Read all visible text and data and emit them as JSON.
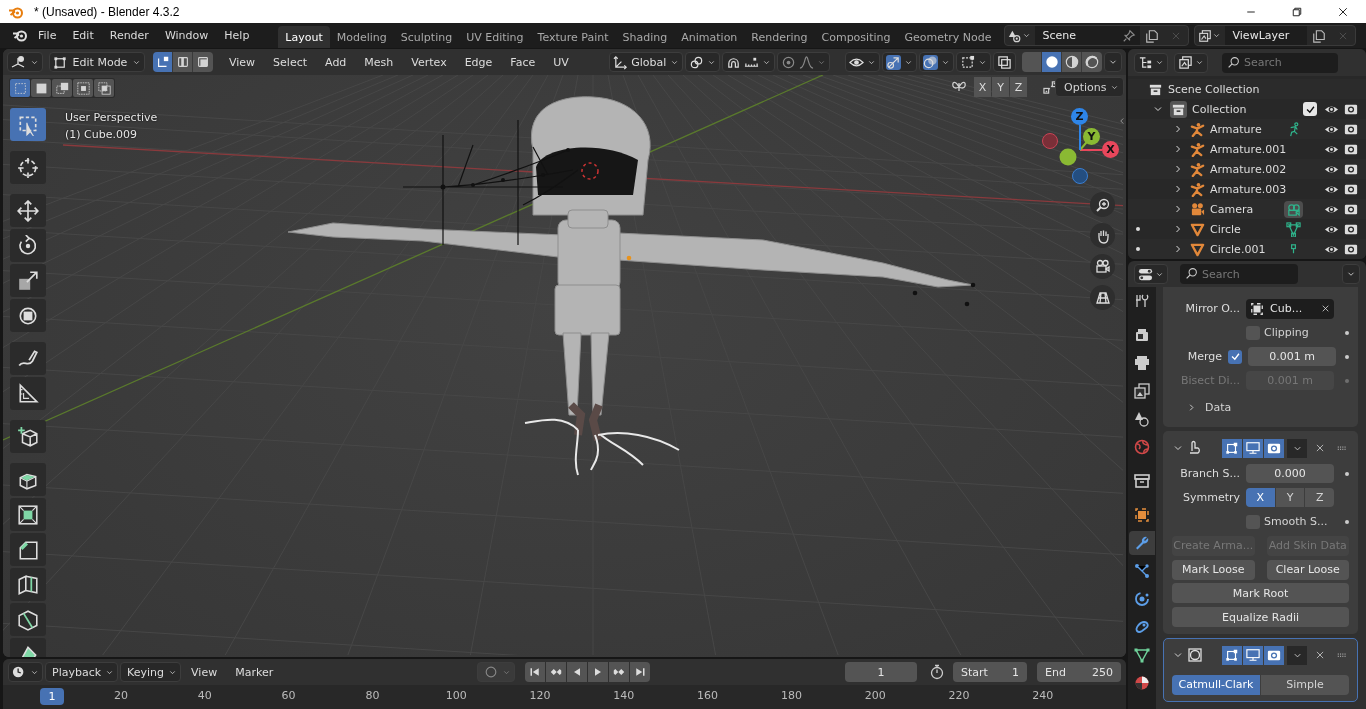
{
  "window": {
    "title": "* (Unsaved) - Blender 4.3.2"
  },
  "menu": [
    "File",
    "Edit",
    "Render",
    "Window",
    "Help"
  ],
  "workspaces": [
    {
      "label": "Layout",
      "selected": true
    },
    {
      "label": "Modeling",
      "selected": false
    },
    {
      "label": "Sculpting",
      "selected": false
    },
    {
      "label": "UV Editing",
      "selected": false
    },
    {
      "label": "Texture Paint",
      "selected": false
    },
    {
      "label": "Shading",
      "selected": false
    },
    {
      "label": "Animation",
      "selected": false
    },
    {
      "label": "Rendering",
      "selected": false
    },
    {
      "label": "Compositing",
      "selected": false
    },
    {
      "label": "Geometry Node",
      "selected": false
    }
  ],
  "scene": "Scene",
  "view_layer": "ViewLayer",
  "viewport_header": {
    "mode": "Edit Mode",
    "select_modes": [
      {
        "kind": "vertex",
        "selected": true
      },
      {
        "kind": "edge",
        "selected": false
      },
      {
        "kind": "face",
        "selected": false
      }
    ],
    "menus": [
      "View",
      "Select",
      "Add",
      "Mesh",
      "Vertex",
      "Edge",
      "Face",
      "UV"
    ],
    "orientation": "Global",
    "gizmos_on": true,
    "overlays_on": true,
    "shading": [
      {
        "kind": "wireframe",
        "selected": false
      },
      {
        "kind": "solid",
        "selected": true
      },
      {
        "kind": "material",
        "selected": false
      },
      {
        "kind": "rendered",
        "selected": false
      }
    ]
  },
  "viewport": {
    "view_name": "User Perspective",
    "object_name": "(1) Cube.009",
    "mirror_axes": [
      {
        "label": "X",
        "selected": false
      },
      {
        "label": "Y",
        "selected": false
      },
      {
        "label": "Z",
        "selected": false
      }
    ],
    "options": "Options",
    "gizmo_axes": [
      {
        "label": "X",
        "color": "#e8475c"
      },
      {
        "label": "Y",
        "color": "#8ab933"
      },
      {
        "label": "Z",
        "color": "#2e85e8"
      }
    ],
    "tools": [
      {
        "kind": "select_box",
        "selected": true
      },
      {
        "kind": "cursor",
        "selected": false
      },
      {
        "kind": "move",
        "selected": false
      },
      {
        "kind": "rotate",
        "selected": false
      },
      {
        "kind": "scale",
        "selected": false
      },
      {
        "kind": "transform",
        "selected": false
      },
      {
        "kind": "annotate",
        "selected": false
      },
      {
        "kind": "measure",
        "selected": false
      },
      {
        "kind": "add_cube",
        "selected": false
      },
      {
        "kind": "extrude",
        "selected": false
      },
      {
        "kind": "inset",
        "selected": false
      },
      {
        "kind": "bevel",
        "selected": false
      },
      {
        "kind": "loop_cut",
        "selected": false
      },
      {
        "kind": "knife",
        "selected": false
      },
      {
        "kind": "poly_build",
        "selected": false
      }
    ]
  },
  "outliner": {
    "search": {
      "placeholder": "Search"
    },
    "root": "Scene Collection",
    "collections": [
      {
        "name": "Collection",
        "expanded": true,
        "checked": true,
        "visible": true,
        "children": [
          {
            "name": "Armature",
            "kind": "armature",
            "data": {
              "kind": "pose",
              "selected": false
            },
            "edit_mode": false,
            "expanded": false,
            "visible": true
          },
          {
            "name": "Armature.001",
            "kind": "armature",
            "edit_mode": false,
            "expanded": false,
            "visible": true
          },
          {
            "name": "Armature.002",
            "kind": "armature",
            "edit_mode": false,
            "expanded": false,
            "visible": true
          },
          {
            "name": "Armature.003",
            "kind": "armature",
            "edit_mode": false,
            "expanded": false,
            "visible": true
          },
          {
            "name": "Camera",
            "kind": "camera",
            "data": {
              "kind": "camera",
              "selected": true
            },
            "edit_mode": false,
            "expanded": false,
            "visible": true
          },
          {
            "name": "Circle",
            "kind": "mesh",
            "data": {
              "kind": "mesh",
              "selected": false
            },
            "edit_mode": true,
            "expanded": false,
            "visible": true
          },
          {
            "name": "Circle.001",
            "kind": "mesh",
            "data": {
              "kind": "vertex",
              "selected": false
            },
            "edit_mode": true,
            "expanded": false,
            "visible": true
          }
        ]
      }
    ]
  },
  "properties": {
    "search": {
      "placeholder": "Search"
    },
    "tabs": [
      {
        "kind": "tool",
        "selected": false
      },
      {
        "kind": "render",
        "selected": false
      },
      {
        "kind": "output",
        "selected": false
      },
      {
        "kind": "view_layer",
        "selected": false
      },
      {
        "kind": "scene",
        "selected": false
      },
      {
        "kind": "world",
        "selected": false
      },
      {
        "kind": "collection",
        "selected": false
      },
      {
        "kind": "object",
        "selected": false
      },
      {
        "kind": "modifiers",
        "selected": true
      },
      {
        "kind": "particles",
        "selected": false
      },
      {
        "kind": "physics",
        "selected": false
      },
      {
        "kind": "constraints",
        "selected": false
      },
      {
        "kind": "data",
        "selected": false
      },
      {
        "kind": "material",
        "selected": false
      }
    ],
    "mirror_modifier": {
      "object_label": "Mirror O...",
      "object_value": "Cub...",
      "clipping": {
        "label": "Clipping",
        "checked": false
      },
      "merge": {
        "label": "Merge",
        "checked": true,
        "value": "0.001 m"
      },
      "bisect": {
        "label": "Bisect Di...",
        "value": "0.001 m",
        "disabled": true
      },
      "data": {
        "label": "Data",
        "expanded": false
      }
    },
    "skin_modifier": {
      "active": false,
      "expanded": true,
      "toggles": [
        {
          "kind": "edit_mode",
          "on": true
        },
        {
          "kind": "viewport",
          "on": true
        },
        {
          "kind": "render",
          "on": true
        }
      ],
      "branch": {
        "label": "Branch S...",
        "value": "0.000"
      },
      "symmetry": {
        "label": "Symmetry",
        "axes": [
          {
            "label": "X",
            "selected": true
          },
          {
            "label": "Y",
            "selected": false
          },
          {
            "label": "Z",
            "selected": false
          }
        ]
      },
      "smooth": {
        "label": "Smooth S...",
        "checked": false
      },
      "buttons": [
        {
          "label": "Create Arma...",
          "disabled": true
        },
        {
          "label": "Add Skin Data",
          "disabled": true
        },
        {
          "label": "Mark Loose",
          "disabled": false
        },
        {
          "label": "Clear Loose",
          "disabled": false
        },
        {
          "label": "Mark Root",
          "disabled": false
        },
        {
          "label": "Equalize Radii",
          "disabled": false
        }
      ]
    },
    "subsurf_modifier": {
      "active": true,
      "expanded": true,
      "toggles": [
        {
          "kind": "edit_mode",
          "on": true
        },
        {
          "kind": "viewport",
          "on": true
        },
        {
          "kind": "render",
          "on": true
        }
      ],
      "methods": [
        {
          "label": "Catmull-Clark",
          "selected": true
        },
        {
          "label": "Simple",
          "selected": false
        }
      ]
    }
  },
  "timeline": {
    "menus": [
      "Playback",
      "Keying",
      "View",
      "Marker"
    ],
    "current_frame": "1",
    "start_label": "Start",
    "start": "1",
    "end_label": "End",
    "end": "250",
    "playhead": "1",
    "ruler": [
      "20",
      "40",
      "60",
      "80",
      "100",
      "120",
      "140",
      "160",
      "180",
      "200",
      "220",
      "240"
    ]
  }
}
